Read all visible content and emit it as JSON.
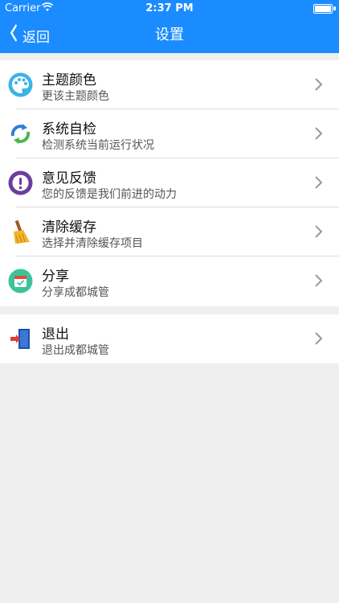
{
  "status_bar": {
    "carrier": "Carrier",
    "time": "2:37 PM"
  },
  "nav": {
    "back_label": "返回",
    "title": "设置"
  },
  "settings": [
    {
      "title": "主题颜色",
      "subtitle": "更该主题颜色",
      "icon": "palette-icon"
    },
    {
      "title": "系统自检",
      "subtitle": "检测系统当前运行状况",
      "icon": "refresh-arrows-icon"
    },
    {
      "title": "意见反馈",
      "subtitle": "您的反馈是我们前进的动力",
      "icon": "feedback-exclamation-icon"
    },
    {
      "title": "清除缓存",
      "subtitle": "选择并清除缓存项目",
      "icon": "broom-icon"
    },
    {
      "title": "分享",
      "subtitle": "分享成都城管",
      "icon": "share-calendar-icon"
    }
  ],
  "logout": {
    "title": "退出",
    "subtitle": "退出成都城管",
    "icon": "exit-door-icon"
  },
  "colors": {
    "accent": "#1a8cff",
    "background": "#efefef"
  }
}
